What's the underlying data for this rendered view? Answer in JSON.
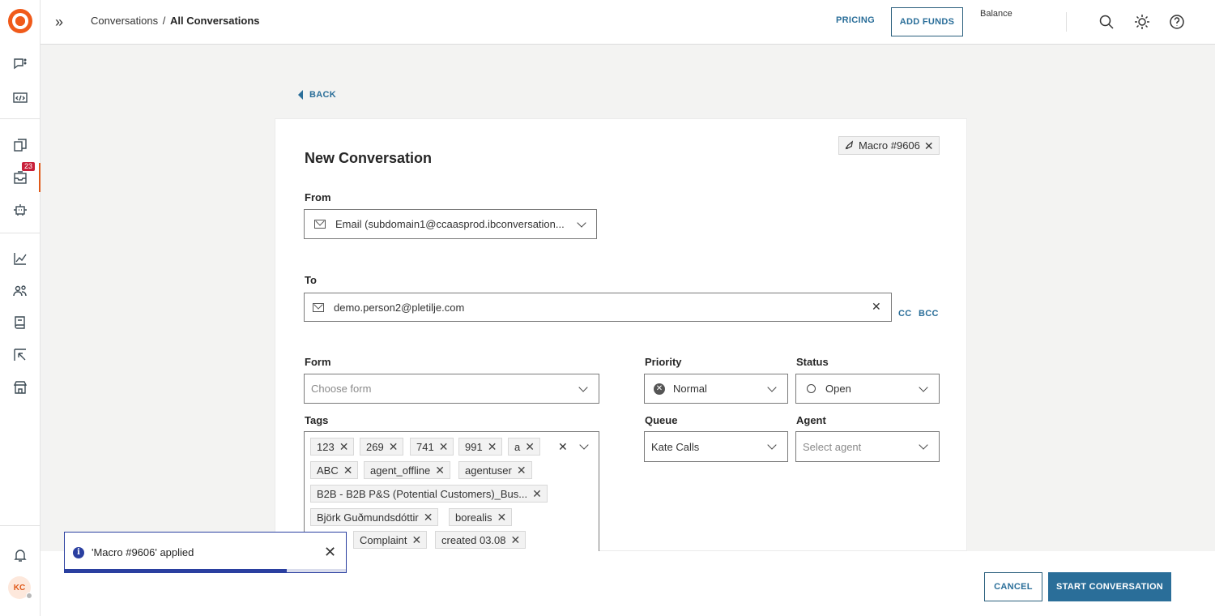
{
  "header": {
    "breadcrumb_root": "Conversations",
    "breadcrumb_sep": "/",
    "breadcrumb_current": "All Conversations",
    "pricing_label": "PRICING",
    "add_funds_label": "ADD FUNDS",
    "balance_label": "Balance"
  },
  "sidebar": {
    "badge_count": "23",
    "avatar_initials": "KC",
    "icons": [
      "chat-icon",
      "code-icon",
      "copy-chat-icon",
      "inbox-icon",
      "bot-icon",
      "analytics-icon",
      "people-icon",
      "book-icon",
      "export-icon",
      "store-icon",
      "bell-icon"
    ]
  },
  "back_label": "BACK",
  "form": {
    "macro_chip": "Macro #9606",
    "title": "New Conversation",
    "from_label": "From",
    "from_value": "Email (subdomain1@ccaasprod.ibconversation...",
    "to_label": "To",
    "to_value": "demo.person2@pletilje.com",
    "cc_label": "CC",
    "bcc_label": "BCC",
    "form_label": "Form",
    "form_placeholder": "Choose form",
    "tags_label": "Tags",
    "tags": [
      "123",
      "269",
      "741",
      "991",
      "a",
      "ABC",
      "agent_offline",
      "agentuser",
      "B2B - B2B P&S (Potential Customers)_Bus...",
      "Björk Guðmundsdóttir",
      "borealis",
      "Complaint",
      "created 03.08"
    ],
    "priority_label": "Priority",
    "priority_value": "Normal",
    "status_label": "Status",
    "status_value": "Open",
    "queue_label": "Queue",
    "queue_value": "Kate Calls",
    "agent_label": "Agent",
    "agent_placeholder": "Select agent"
  },
  "toast": {
    "message": "'Macro #9606' applied",
    "progress": 0.79
  },
  "footer": {
    "cancel_label": "CANCEL",
    "start_label": "START CONVERSATION"
  },
  "colors": {
    "accent": "#2a6e99",
    "brand": "#f05a1a",
    "badge": "#c8203a",
    "toast": "#2a3fa0"
  }
}
